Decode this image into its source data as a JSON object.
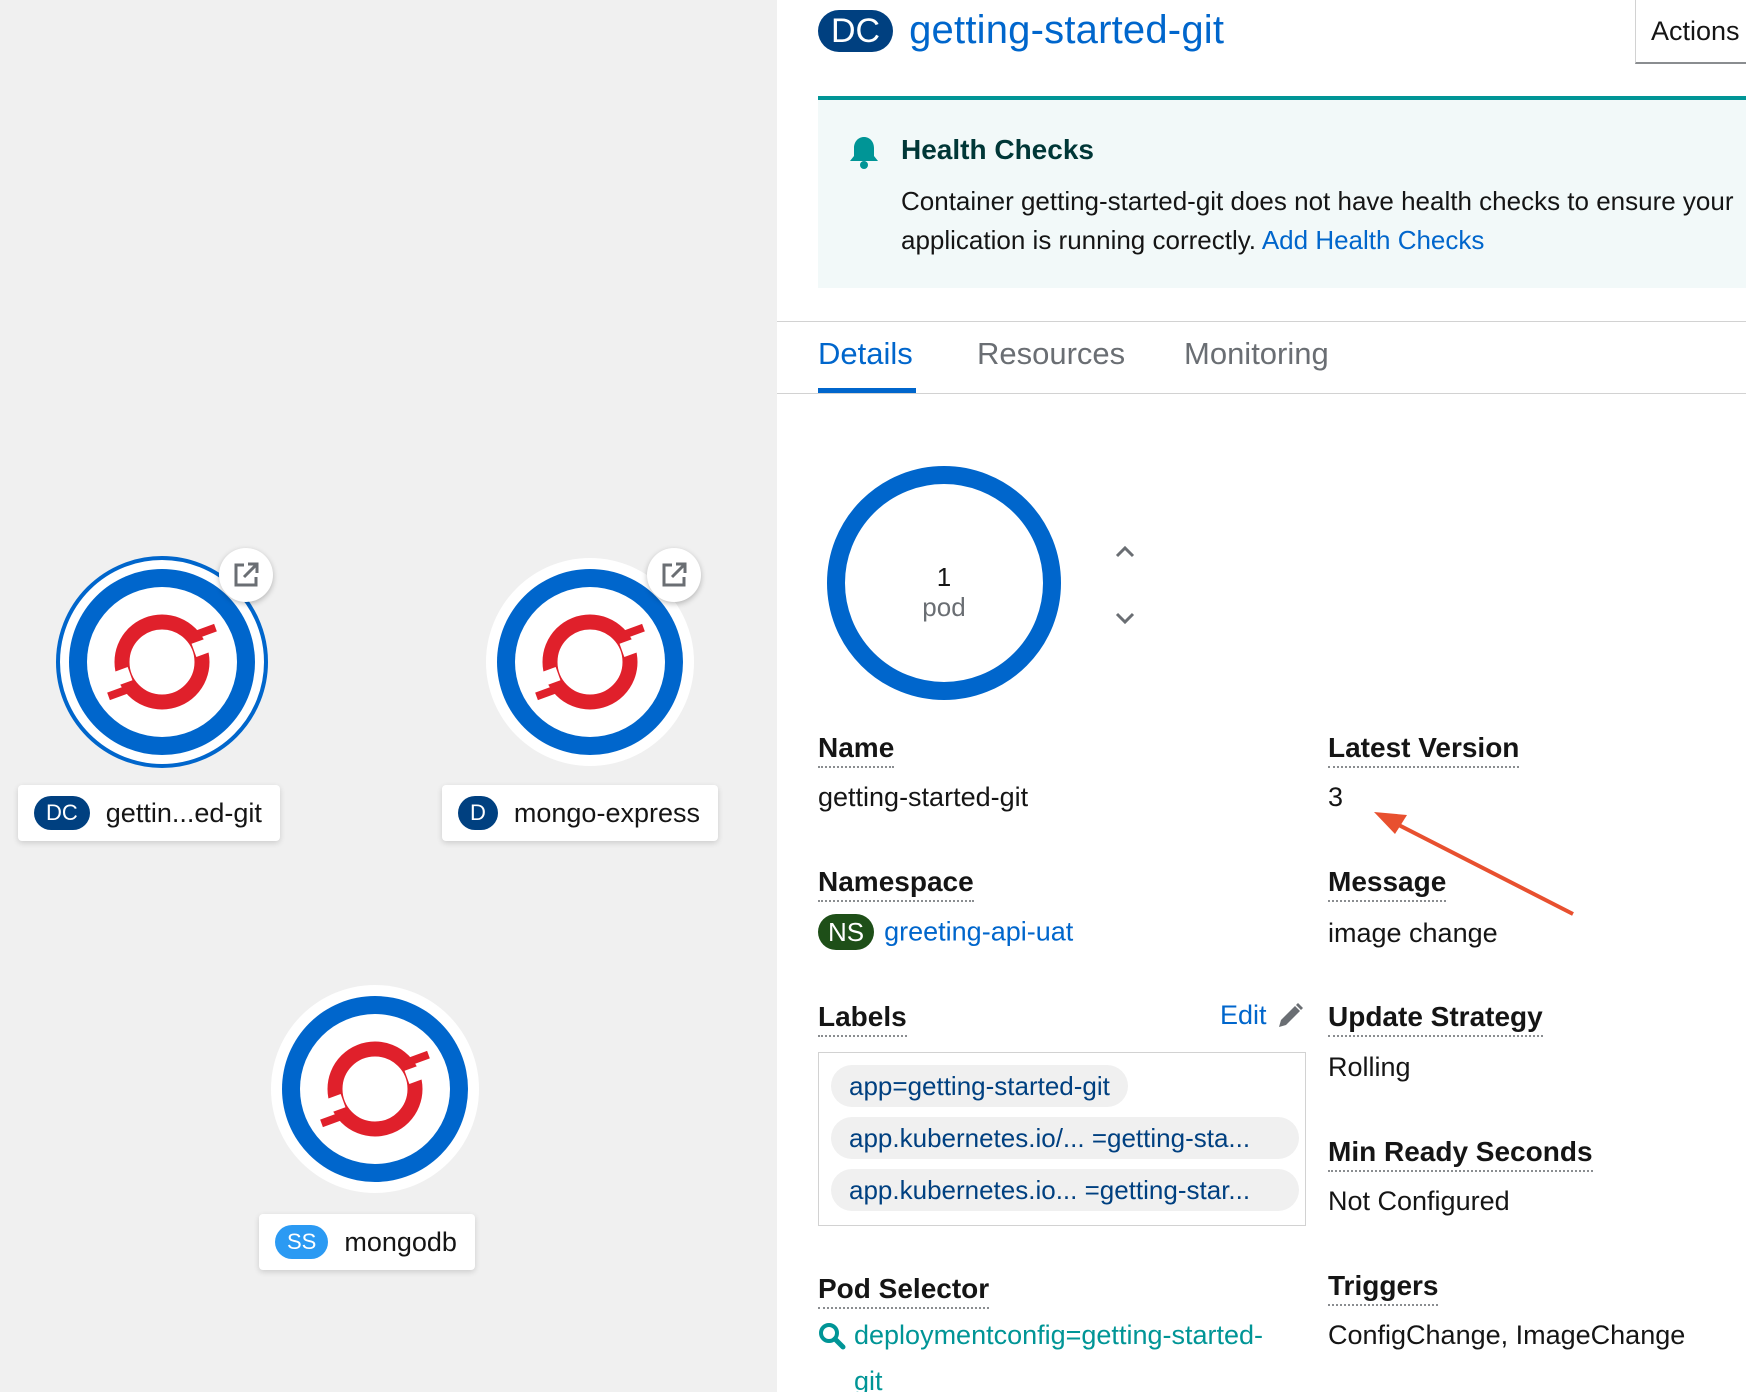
{
  "topology": {
    "nodes": [
      {
        "kind": "DC",
        "label": "gettin...ed-git",
        "has_link": true,
        "selected": true
      },
      {
        "kind": "D",
        "label": "mongo-express",
        "has_link": true,
        "selected": false
      },
      {
        "kind": "SS",
        "label": "mongodb",
        "has_link": false,
        "selected": false
      }
    ],
    "icons": {
      "external_link": "external-link-icon",
      "node_logo": "openshift-logo"
    }
  },
  "panel": {
    "kind_badge": "DC",
    "title": "getting-started-git",
    "actions_label": "Actions",
    "alert": {
      "icon": "bell-icon",
      "title": "Health Checks",
      "body_line1": "Container getting-started-git does not have health checks to ensure your",
      "body_line2": "application is running correctly.",
      "link_text": "Add Health Checks"
    },
    "tabs": [
      "Details",
      "Resources",
      "Monitoring"
    ],
    "active_tab": "Details",
    "pods": {
      "count": "1",
      "unit": "pod"
    },
    "details": {
      "name_label": "Name",
      "name_value": "getting-started-git",
      "namespace_label": "Namespace",
      "namespace_badge": "NS",
      "namespace_value": "greeting-api-uat",
      "labels_label": "Labels",
      "labels_edit": "Edit",
      "labels": [
        "app=getting-started-git",
        "app.kubernetes.io/... =getting-sta...",
        "app.kubernetes.io... =getting-star..."
      ],
      "pod_selector_label": "Pod Selector",
      "pod_selector_value": "deploymentconfig=getting-started-",
      "pod_selector_value_cont": "git",
      "latest_version_label": "Latest Version",
      "latest_version_value": "3",
      "message_label": "Message",
      "message_value": "image change",
      "update_strategy_label": "Update Strategy",
      "update_strategy_value": "Rolling",
      "min_ready_label": "Min Ready Seconds",
      "min_ready_value": "Not Configured",
      "triggers_label": "Triggers",
      "triggers_value": "ConfigChange, ImageChange"
    }
  },
  "colors": {
    "link_blue": "#0066cc",
    "pod_ring": "#0066cc",
    "alert_teal": "#009596",
    "annotation_arrow": "#e8502f",
    "openshift_red": "#e0202b"
  }
}
